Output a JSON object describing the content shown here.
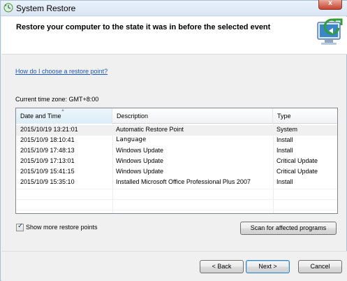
{
  "window": {
    "title": "System Restore"
  },
  "header": {
    "text": "Restore your computer to the state it was in before the selected event"
  },
  "help_link": "How do I choose a restore point?",
  "timezone_label": "Current time zone: GMT+8:00",
  "list": {
    "columns": [
      "Date and Time",
      "Description",
      "Type"
    ],
    "rows": [
      {
        "date": "2015/10/19 13:21:01",
        "description": "Automatic Restore Point",
        "type": "System"
      },
      {
        "date": "2015/10/9 18:10:41",
        "description": "Language",
        "type": "Install"
      },
      {
        "date": "2015/10/9 17:48:13",
        "description": "Windows Update",
        "type": "Install"
      },
      {
        "date": "2015/10/9 17:13:01",
        "description": "Windows Update",
        "type": "Critical Update"
      },
      {
        "date": "2015/10/9 15:41:15",
        "description": "Windows Update",
        "type": "Critical Update"
      },
      {
        "date": "2015/10/9 15:35:10",
        "description": "Installed Microsoft Office Professional Plus 2007",
        "type": "Install"
      }
    ]
  },
  "show_more_checkbox": {
    "label": "Show more restore points",
    "checked": true
  },
  "buttons": {
    "scan": "Scan for affected programs",
    "back": "< Back",
    "next": "Next >",
    "cancel": "Cancel",
    "close": "x"
  },
  "colors": {
    "link": "#1b56c1",
    "close_button": "#c7432e",
    "selected_row": "#f0f0f0"
  },
  "icons": {
    "title": "system-restore-icon",
    "header": "system-restore-monitor-icon",
    "checkmark": "✓"
  }
}
